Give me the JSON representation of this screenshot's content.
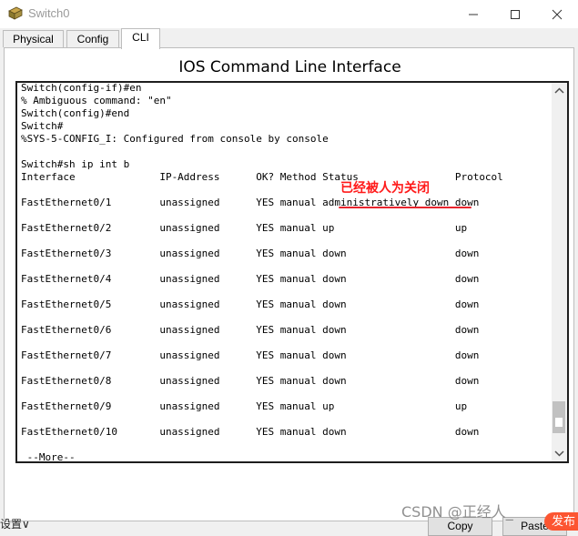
{
  "window": {
    "title": "Switch0",
    "minimize_icon": "minimize-icon",
    "maximize_icon": "maximize-icon",
    "close_icon": "close-icon"
  },
  "tabs": [
    {
      "label": "Physical",
      "active": false
    },
    {
      "label": "Config",
      "active": false
    },
    {
      "label": "CLI",
      "active": true
    }
  ],
  "panel": {
    "title": "IOS Command Line Interface"
  },
  "terminal": {
    "lines": [
      "Switch(config-if)#en",
      "% Ambiguous command: \"en\"",
      "Switch(config)#end",
      "Switch#",
      "%SYS-5-CONFIG_I: Configured from console by console",
      "",
      "Switch#sh ip int b",
      "Interface              IP-Address      OK? Method Status                Protocol",
      "",
      "FastEthernet0/1        unassigned      YES manual administratively down down",
      "",
      "FastEthernet0/2        unassigned      YES manual up                    up",
      "",
      "FastEthernet0/3        unassigned      YES manual down                  down",
      "",
      "FastEthernet0/4        unassigned      YES manual down                  down",
      "",
      "FastEthernet0/5        unassigned      YES manual down                  down",
      "",
      "FastEthernet0/6        unassigned      YES manual down                  down",
      "",
      "FastEthernet0/7        unassigned      YES manual down                  down",
      "",
      "FastEthernet0/8        unassigned      YES manual down                  down",
      "",
      "FastEthernet0/9        unassigned      YES manual up                    up",
      "",
      "FastEthernet0/10       unassigned      YES manual down                  down",
      "",
      " --More--"
    ],
    "scroll_up_icon": "scroll-up-icon",
    "scroll_down_icon": "scroll-down-icon"
  },
  "annotation": {
    "text": "已经被人为关闭",
    "color": "#ff1a1a"
  },
  "buttons": {
    "copy_label": "Copy",
    "paste_label": "Paste"
  },
  "watermark": "CSDN @正经人_",
  "background": {
    "settings_label": "设置",
    "publish_label": "发布"
  }
}
